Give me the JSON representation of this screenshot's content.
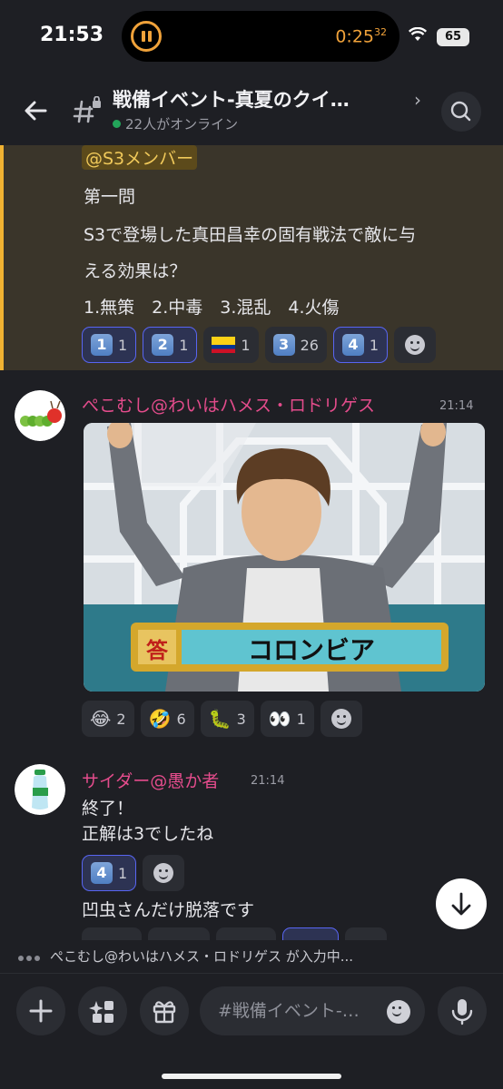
{
  "status_bar": {
    "time": "21:53",
    "timer": "0:25",
    "timer_sub": "32",
    "battery": "65"
  },
  "header": {
    "title": "戦備イベント-真夏のクイ…",
    "online": "22人がオンライン"
  },
  "quiz_message": {
    "mention": "@S3メンバー",
    "lines": [
      "第一問",
      "S3で登場した真田昌幸の固有戦法で敵に与",
      "える効果は？",
      " 1.無策　2.中毒　3.混乱　4.火傷"
    ],
    "reactions": [
      {
        "emoji": "1️⃣",
        "label": "1",
        "count": "1",
        "mine": true
      },
      {
        "emoji": "2️⃣",
        "label": "2",
        "count": "1",
        "mine": true
      },
      {
        "emoji": "🇨🇴",
        "label": "",
        "count": "1",
        "mine": false
      },
      {
        "emoji": "3️⃣",
        "label": "3",
        "count": "26",
        "mine": false
      },
      {
        "emoji": "4️⃣",
        "label": "4",
        "count": "1",
        "mine": true
      }
    ]
  },
  "message_pekomushi": {
    "username": "ぺこむし@わいはハメス・ロドリゲス",
    "timestamp": "21:14",
    "image_caption_label": "答",
    "image_caption": "コロンビア",
    "reactions": [
      {
        "emoji": "😂",
        "count": "2"
      },
      {
        "emoji": "🤣",
        "count": "6"
      },
      {
        "emoji": "🐛",
        "count": "3"
      },
      {
        "emoji": "👀",
        "count": "1"
      }
    ]
  },
  "message_cider": {
    "username": "サイダー@愚か者",
    "timestamp": "21:14",
    "lines": [
      "終了！",
      "正解は3でしたね"
    ],
    "reaction": {
      "label": "4",
      "count": "1"
    },
    "followup": "凹虫さんだけ脱落です"
  },
  "typing": {
    "text": "ぺこむし@わいはハメス・ロドリゲス が入力中..."
  },
  "composer": {
    "placeholder": "#戦備イベント-…"
  },
  "colors": {
    "accent": "#5865f2",
    "mention_bg": "#5c4a1b",
    "highlight_border": "#f0b232",
    "username": "#e44c8c",
    "online": "#23a55a"
  }
}
